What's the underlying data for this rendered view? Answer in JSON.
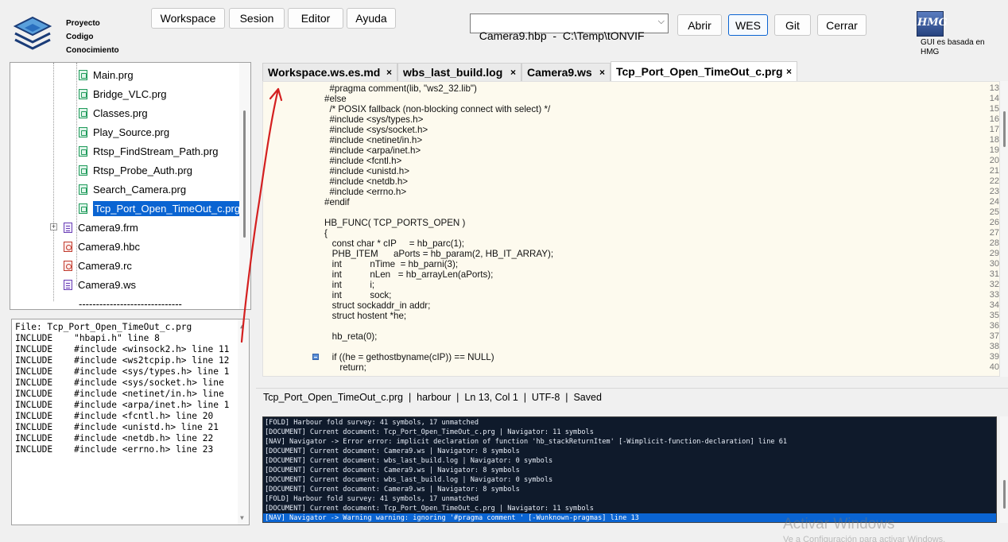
{
  "header": {
    "logo_icon": "layers-logo-icon",
    "logo_lines": [
      "Proyecto",
      "Codigo",
      "Conocimiento"
    ],
    "menu": [
      "Workspace",
      "Sesion",
      "Editor",
      "Ayuda"
    ],
    "project_combo_value": "Camera9.hbp  -  C:\\Temp\\tONVIF",
    "actions": [
      "Abrir",
      "WES",
      "Git",
      "Cerrar"
    ],
    "hmg_logo_text": "HMG",
    "hmg_caption": "GUI es basada en HMG"
  },
  "tree": {
    "items": [
      {
        "label": "Main.prg",
        "icon": "prg-file-icon"
      },
      {
        "label": "Bridge_VLC.prg",
        "icon": "prg-file-icon"
      },
      {
        "label": "Classes.prg",
        "icon": "prg-file-icon"
      },
      {
        "label": "Play_Source.prg",
        "icon": "prg-file-icon"
      },
      {
        "label": "Rtsp_FindStream_Path.prg",
        "icon": "prg-file-icon"
      },
      {
        "label": "Rtsp_Probe_Auth.prg",
        "icon": "prg-file-icon"
      },
      {
        "label": "Search_Camera.prg",
        "icon": "prg-file-icon"
      },
      {
        "label": "Tcp_Port_Open_TimeOut_c.prg",
        "icon": "prg-file-icon",
        "selected": true
      },
      {
        "label": "Camera9.frm",
        "icon": "form-file-icon"
      },
      {
        "label": "Camera9.hbc",
        "icon": "hbc-file-icon"
      },
      {
        "label": "Camera9.rc",
        "icon": "rc-file-icon"
      },
      {
        "label": "Camera9.ws",
        "icon": "ws-file-icon"
      },
      {
        "label": "------------------------------",
        "icon": ""
      }
    ]
  },
  "includes": {
    "lines": [
      "File: Tcp_Port_Open_TimeOut_c.prg",
      "INCLUDE    \"hbapi.h\" line 8",
      "INCLUDE    #include <winsock2.h> line 11",
      "INCLUDE    #include <ws2tcpip.h> line 12",
      "INCLUDE    #include <sys/types.h> line 1",
      "INCLUDE    #include <sys/socket.h> line",
      "INCLUDE    #include <netinet/in.h> line",
      "INCLUDE    #include <arpa/inet.h> line 1",
      "INCLUDE    #include <fcntl.h> line 20",
      "INCLUDE    #include <unistd.h> line 21",
      "INCLUDE    #include <netdb.h> line 22",
      "INCLUDE    #include <errno.h> line 23"
    ]
  },
  "tabs": [
    {
      "label": "Workspace.ws.es.md",
      "close": "×"
    },
    {
      "label": "wbs_last_build.log",
      "close": "×"
    },
    {
      "label": "Camera9.ws",
      "close": "×"
    },
    {
      "label": "Tcp_Port_Open_TimeOut_c.prg",
      "close": "×",
      "active": true
    }
  ],
  "editor": {
    "lines": [
      {
        "n": "13",
        "t": "  #pragma comment(lib, \"ws2_32.lib\")"
      },
      {
        "n": "14",
        "t": "#else"
      },
      {
        "n": "15",
        "t": "  /* POSIX fallback (non-blocking connect with select) */"
      },
      {
        "n": "16",
        "t": "  #include <sys/types.h>"
      },
      {
        "n": "17",
        "t": "  #include <sys/socket.h>"
      },
      {
        "n": "18",
        "t": "  #include <netinet/in.h>"
      },
      {
        "n": "19",
        "t": "  #include <arpa/inet.h>"
      },
      {
        "n": "20",
        "t": "  #include <fcntl.h>"
      },
      {
        "n": "21",
        "t": "  #include <unistd.h>"
      },
      {
        "n": "22",
        "t": "  #include <netdb.h>"
      },
      {
        "n": "23",
        "t": "  #include <errno.h>"
      },
      {
        "n": "24",
        "t": "#endif"
      },
      {
        "n": "25",
        "t": ""
      },
      {
        "n": "26",
        "t": "HB_FUNC( TCP_PORTS_OPEN )"
      },
      {
        "n": "27",
        "t": "{"
      },
      {
        "n": "28",
        "t": "   const char * cIP     = hb_parc(1);"
      },
      {
        "n": "29",
        "t": "   PHB_ITEM      aPorts = hb_param(2, HB_IT_ARRAY);"
      },
      {
        "n": "30",
        "t": "   int           nTime  = hb_parni(3);"
      },
      {
        "n": "31",
        "t": "   int           nLen   = hb_arrayLen(aPorts);"
      },
      {
        "n": "32",
        "t": "   int           i;"
      },
      {
        "n": "33",
        "t": "   int           sock;"
      },
      {
        "n": "34",
        "t": "   struct sockaddr_in addr;"
      },
      {
        "n": "35",
        "t": "   struct hostent *he;"
      },
      {
        "n": "36",
        "t": ""
      },
      {
        "n": "37",
        "t": "   hb_reta(0);"
      },
      {
        "n": "38",
        "t": ""
      },
      {
        "n": "39",
        "t": "   if ((he = gethostbyname(cIP)) == NULL)",
        "fold": true
      },
      {
        "n": "40",
        "t": "      return;"
      }
    ]
  },
  "status_bar": "Tcp_Port_Open_TimeOut_c.prg  |  harbour  |  Ln 13, Col 1  |  UTF-8  |  Saved",
  "log": {
    "lines": [
      "[FOLD] Harbour fold survey: 41 symbols, 17 unmatched",
      "[DOCUMENT] Current document: Tcp_Port_Open_TimeOut_c.prg | Navigator: 11 symbols",
      "[NAV] Navigator -> Error error: implicit declaration of function 'hb_stackReturnItem' [-Wimplicit-function-declaration] line 61",
      "[DOCUMENT] Current document: Camera9.ws | Navigator: 8 symbols",
      "[DOCUMENT] Current document: wbs_last_build.log | Navigator: 0 symbols",
      "[DOCUMENT] Current document: Camera9.ws | Navigator: 8 symbols",
      "[DOCUMENT] Current document: wbs_last_build.log | Navigator: 0 symbols",
      "[DOCUMENT] Current document: Camera9.ws | Navigator: 8 symbols",
      "[FOLD] Harbour fold survey: 41 symbols, 17 unmatched",
      "[DOCUMENT] Current document: Tcp_Port_Open_TimeOut_c.prg | Navigator: 11 symbols",
      "[NAV] Navigator -> Warning warning: ignoring '#pragma comment ' [-Wunknown-pragmas] line 13"
    ]
  },
  "watermark": {
    "title": "Activar Windows",
    "subtitle": "Ve a Configuración para activar Windows."
  },
  "colors": {
    "accent": "#0a64d2",
    "editor_bg": "#fdfaee",
    "log_bg": "#0f1a2b",
    "annotation": "#d42020"
  }
}
